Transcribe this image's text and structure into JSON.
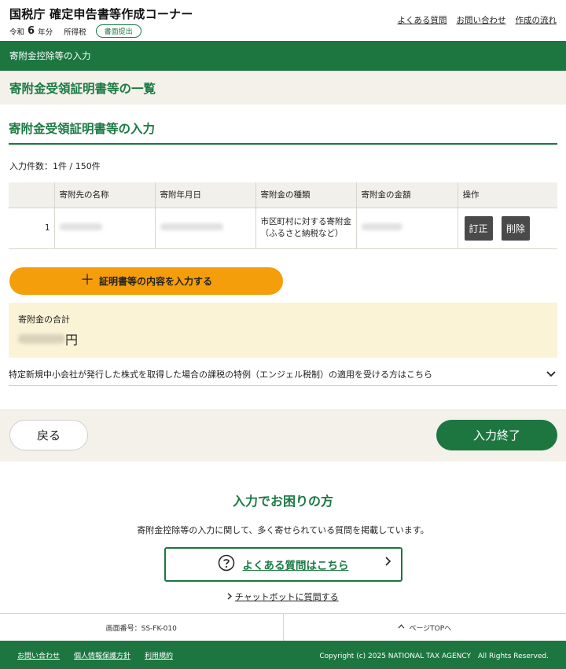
{
  "header": {
    "title": "国税庁 確定申告書等作成コーナー",
    "era": "令和",
    "year": "6",
    "year_suffix": "年分",
    "tax_type": "所得税",
    "badge": "書面提出",
    "links": [
      "よくある質問",
      "お問い合わせ",
      "作成の流れ"
    ]
  },
  "breadcrumb": "寄附金控除等の入力",
  "page_title": "寄附金受領証明書等の一覧",
  "section_title": "寄附金受領証明書等の入力",
  "count_text": "入力件数：1件 / 150件",
  "table": {
    "headers": [
      "",
      "寄附先の名称",
      "寄附年月日",
      "寄附金の種類",
      "寄附金の金額",
      "操作"
    ],
    "rows": [
      {
        "no": "1",
        "kind_line1": "市区町村に対する寄附金",
        "kind_line2": "（ふるさと納税など）",
        "edit_label": "訂正",
        "delete_label": "削除"
      }
    ]
  },
  "add_button": "証明書等の内容を入力する",
  "total": {
    "label": "寄附金の合計",
    "unit": "円"
  },
  "angel_text": "特定新規中小会社が発行した株式を取得した場合の課税の特例（エンジェル税制）の適用を受ける方はこちら",
  "nav": {
    "back": "戻る",
    "done": "入力終了"
  },
  "help": {
    "title": "入力でお困りの方",
    "text": "寄附金控除等の入力に関して、多く寄せられている質問を掲載しています。",
    "faq_button": "よくある質問はこちら",
    "chatbot": "チャットボットに質問する"
  },
  "footer": {
    "screen_id": "画面番号：SS-FK-010",
    "page_top": "ページTOPへ",
    "links": [
      "お問い合わせ",
      "個人情報保護方針",
      "利用規約"
    ],
    "copyright": "Copyright (c) 2025 NATIONAL TAX AGENCY　All Rights Reserved."
  },
  "colors": {
    "brand_green": "#1d7640",
    "accent_orange": "#f59e0b",
    "band_beige": "#f3f1ea",
    "total_cream": "#fbf3d6"
  }
}
